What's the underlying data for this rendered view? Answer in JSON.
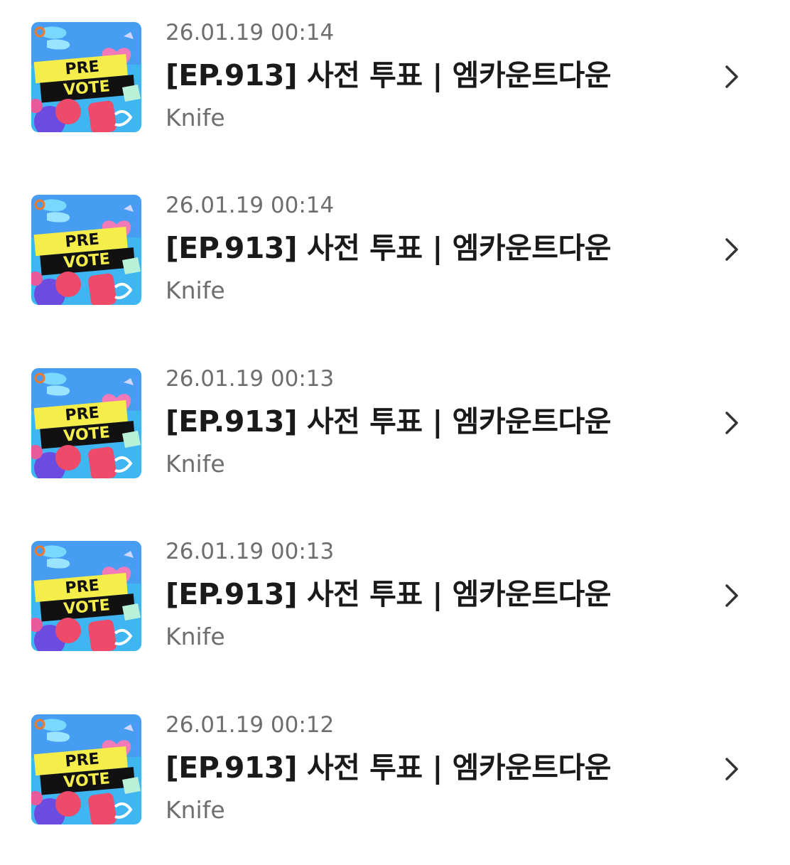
{
  "items": [
    {
      "thumbnail_line1": "PRE",
      "thumbnail_line2": "VOTE",
      "date": "26.01.19 00:14",
      "title": "[EP.913] 사전 투표 | 엠카운트다운",
      "author": "Knife",
      "action_icon": "chevron-right-icon"
    },
    {
      "thumbnail_line1": "PRE",
      "thumbnail_line2": "VOTE",
      "date": "26.01.19 00:14",
      "title": "[EP.913] 사전 투표 | 엠카운트다운",
      "author": "Knife",
      "action_icon": "chevron-right-icon"
    },
    {
      "thumbnail_line1": "PRE",
      "thumbnail_line2": "VOTE",
      "date": "26.01.19 00:13",
      "title": "[EP.913] 사전 투표 | 엠카운트다운",
      "author": "Knife",
      "action_icon": "chevron-right-icon"
    },
    {
      "thumbnail_line1": "PRE",
      "thumbnail_line2": "VOTE",
      "date": "26.01.19 00:13",
      "title": "[EP.913] 사전 투표 | 엠카운트다운",
      "author": "Knife",
      "action_icon": "chevron-right-icon"
    },
    {
      "thumbnail_line1": "PRE",
      "thumbnail_line2": "VOTE",
      "date": "26.01.19 00:12",
      "title": "[EP.913] 사전 투표 | 엠카운트다운",
      "author": "Knife",
      "action_icon": "chevron-right-icon"
    }
  ],
  "colors": {
    "thumbnail_bg": "#3fb6f2",
    "banner_yellow": "#f5ee4a",
    "banner_black": "#111111",
    "heart_pink": "#f27ab8",
    "accent_purple": "#6b4be0",
    "accent_red": "#ee4a6a"
  }
}
